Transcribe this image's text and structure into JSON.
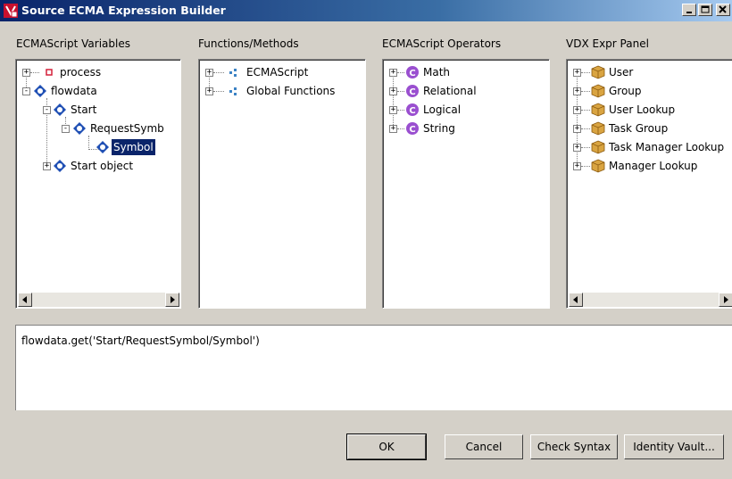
{
  "window": {
    "title": "Source ECMA Expression Builder",
    "title_icon": "novell-app-icon",
    "buttons": [
      "minimize",
      "maximize",
      "close"
    ]
  },
  "panels": {
    "variables": {
      "label": "ECMAScript Variables",
      "items": [
        {
          "label": "process",
          "icon": "red-square-icon",
          "expander": "+"
        },
        {
          "label": "flowdata",
          "icon": "diamond-node-icon",
          "expander": "-"
        },
        {
          "label": "Start",
          "icon": "diamond-node-icon",
          "expander": "-"
        },
        {
          "label": "RequestSymb",
          "icon": "diamond-node-icon",
          "expander": "-"
        },
        {
          "label": "Symbol",
          "icon": "diamond-node-icon",
          "expander": "",
          "selected": true
        },
        {
          "label": "Start object",
          "icon": "diamond-node-icon",
          "expander": "+"
        }
      ]
    },
    "functions": {
      "label": "Functions/Methods",
      "items": [
        {
          "label": "ECMAScript",
          "icon": "dots-icon",
          "expander": "+"
        },
        {
          "label": "Global Functions",
          "icon": "dots-icon",
          "expander": "+"
        }
      ]
    },
    "operators": {
      "label": "ECMAScript Operators",
      "items": [
        {
          "label": "Math",
          "icon": "class-c-icon",
          "expander": "+"
        },
        {
          "label": "Relational",
          "icon": "class-c-icon",
          "expander": "+"
        },
        {
          "label": "Logical",
          "icon": "class-c-icon",
          "expander": "+"
        },
        {
          "label": "String",
          "icon": "class-c-icon",
          "expander": "+"
        }
      ]
    },
    "vdx": {
      "label": "VDX Expr Panel",
      "items": [
        {
          "label": "User",
          "icon": "cube-icon",
          "expander": "+"
        },
        {
          "label": "Group",
          "icon": "cube-icon",
          "expander": "+"
        },
        {
          "label": "User Lookup",
          "icon": "cube-icon",
          "expander": "+"
        },
        {
          "label": "Task Group",
          "icon": "cube-icon",
          "expander": "+"
        },
        {
          "label": "Task Manager Lookup",
          "icon": "cube-icon",
          "expander": "+"
        },
        {
          "label": "Manager Lookup",
          "icon": "cube-icon",
          "expander": "+"
        }
      ]
    }
  },
  "expression": "flowdata.get('Start/RequestSymbol/Symbol')",
  "buttons": {
    "ok": "OK",
    "cancel": "Cancel",
    "check_syntax": "Check Syntax",
    "identity_vault": "Identity Vault..."
  },
  "colors": {
    "titlebar": "#0a246a",
    "selection": "#0a246a",
    "dialog": "#d4d0c8",
    "diamond_node": "#1f4fb4",
    "class_c": "#9a4fd0",
    "cube": "#d9a441",
    "red_square": "#d4203a"
  }
}
